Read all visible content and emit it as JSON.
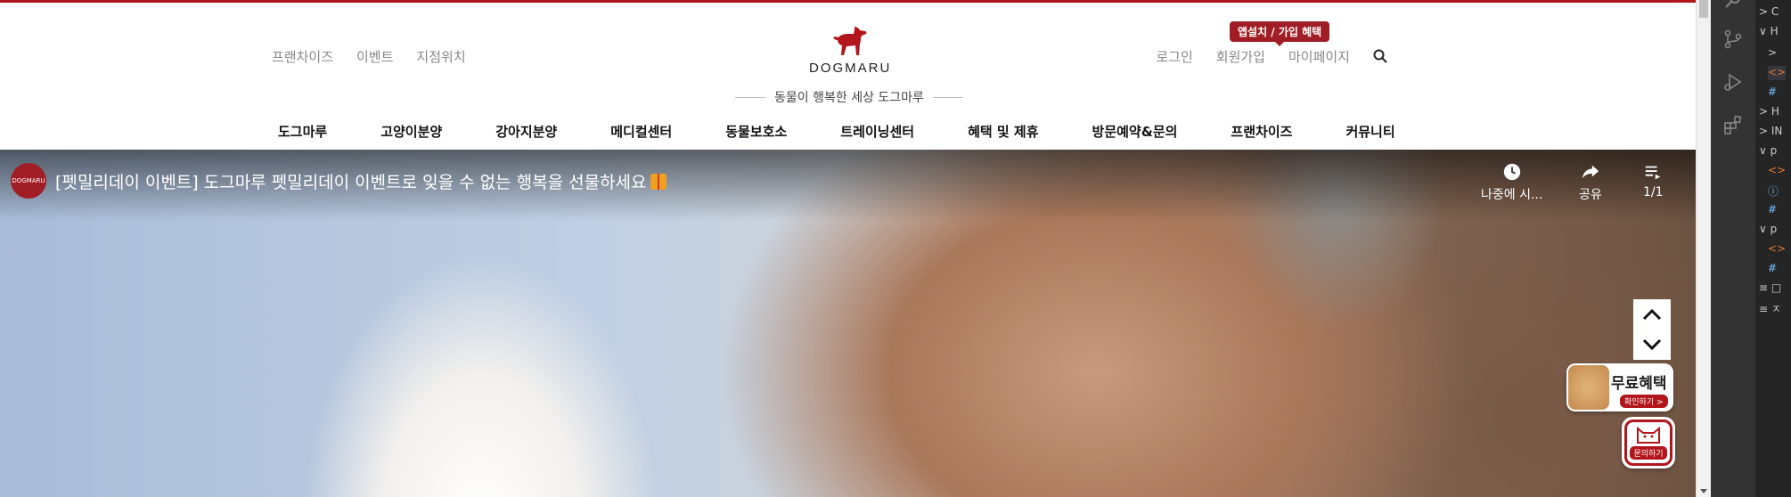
{
  "header": {
    "left_nav": [
      "프랜차이즈",
      "이벤트",
      "지점위치"
    ],
    "right_nav": [
      "로그인",
      "회원가입",
      "마이페이지"
    ],
    "badge": "앱설치 / 가입 혜택",
    "logo_text": "DOGMARU",
    "tagline": "동물이 행복한 세상 도그마루",
    "main_nav": [
      "도그마루",
      "고양이분양",
      "강아지분양",
      "메디컬센터",
      "동물보호소",
      "트레이닝센터",
      "혜택 및 제휴",
      "방문예약&문의",
      "프랜차이즈",
      "커뮤니티"
    ],
    "accent_color": "#b3151c",
    "icons": [
      "search-icon",
      "dog-logo-icon"
    ]
  },
  "video": {
    "channel_name": "DOGMARU",
    "title": "[펫밀리데이 이벤트] 도그마루 펫밀리데이 이벤트로 잊을 수 없는 행복을 선물하세요",
    "controls": {
      "watch_later": "나중에 시...",
      "share": "공유",
      "playlist": "1/1"
    }
  },
  "floating": {
    "free_benefit_title": "무료혜택",
    "free_benefit_sub": "확인하기 >",
    "inquiry_label": "문의하기",
    "icons": [
      "chevron-up-icon",
      "chevron-down-icon",
      "cat-icon"
    ]
  },
  "ide": {
    "tree_rows": [
      {
        "glyph": ">",
        "text": "C"
      },
      {
        "glyph": "∨",
        "text": "H"
      },
      {
        "glyph": ">",
        "text": ""
      },
      {
        "glyph": "<>",
        "text": ""
      },
      {
        "glyph": "#",
        "text": ""
      },
      {
        "glyph": ">",
        "text": "H"
      },
      {
        "glyph": ">",
        "text": "IN"
      },
      {
        "glyph": "∨",
        "text": "p"
      },
      {
        "glyph": "<>",
        "text": ""
      },
      {
        "glyph": "ⓘ",
        "text": ""
      },
      {
        "glyph": "#",
        "text": ""
      },
      {
        "glyph": "∨",
        "text": "p"
      },
      {
        "glyph": "<>",
        "text": ""
      },
      {
        "glyph": "#",
        "text": ""
      },
      {
        "glyph": "≡",
        "text": "□"
      },
      {
        "glyph": "≡",
        "text": "ㅈ"
      }
    ]
  }
}
